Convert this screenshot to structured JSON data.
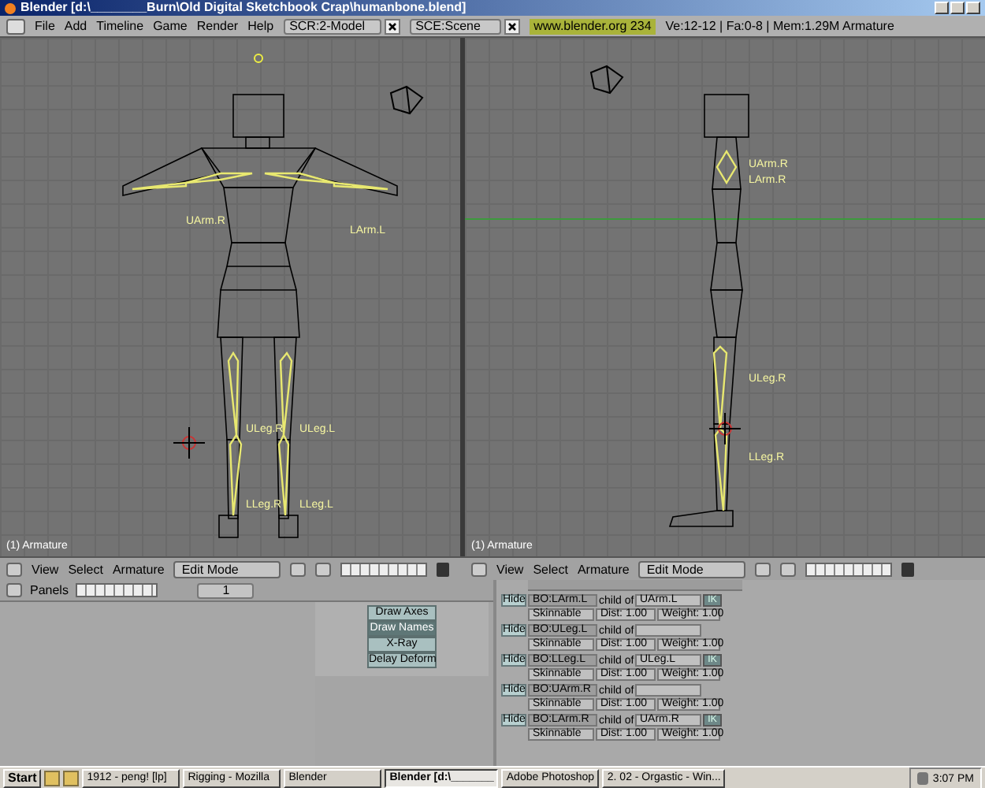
{
  "window": {
    "title": "Blender [d:\\________Burn\\Old Digital Sketchbook Crap\\humanbone.blend]"
  },
  "menu_bar": {
    "menus": [
      "File",
      "Add",
      "Timeline",
      "Game",
      "Render",
      "Help"
    ],
    "screen": "SCR:2-Model",
    "scene": "SCE:Scene",
    "version": "www.blender.org 234",
    "stats": "Ve:12-12 | Fa:0-8 | Mem:1.29M Armature"
  },
  "viewports": [
    {
      "kind": "front",
      "object_label": "(1) Armature",
      "bone_labels": [
        "UArm.R",
        "LArm.L",
        "ULeg.R",
        "ULeg.L",
        "LLeg.R",
        "LLeg.L"
      ],
      "header": {
        "menus": [
          "View",
          "Select",
          "Armature"
        ],
        "mode": "Edit Mode"
      }
    },
    {
      "kind": "side",
      "object_label": "(1) Armature",
      "bone_labels": [
        "UArm.R",
        "LArm.R",
        "ULeg.R",
        "LLeg.R"
      ],
      "header": {
        "menus": [
          "View",
          "Select",
          "Armature"
        ],
        "mode": "Edit Mode"
      }
    }
  ],
  "buttons_header": {
    "panels": "Panels",
    "frame": "1"
  },
  "draw_buttons": [
    {
      "label": "Draw Axes",
      "selected": false
    },
    {
      "label": "Draw Names",
      "selected": true
    },
    {
      "label": "X-Ray",
      "selected": false
    },
    {
      "label": "Delay Deform",
      "selected": false
    }
  ],
  "bones": [
    {
      "hide": "Hide",
      "name": "BO:LArm.L",
      "child_of": "child of",
      "parent": "UArm.L",
      "ik": "IK",
      "skinnable": "Skinnable",
      "dist": "Dist: 1.00",
      "weight": "Weight: 1.00"
    },
    {
      "hide": "Hide",
      "name": "BO:ULeg.L",
      "child_of": "child of",
      "skinnable": "Skinnable",
      "dist": "Dist: 1.00",
      "weight": "Weight: 1.00"
    },
    {
      "hide": "Hide",
      "name": "BO:LLeg.L",
      "child_of": "child of",
      "parent": "ULeg.L",
      "ik": "IK",
      "skinnable": "Skinnable",
      "dist": "Dist: 1.00",
      "weight": "Weight: 1.00"
    },
    {
      "hide": "Hide",
      "name": "BO:UArm.R",
      "child_of": "child of",
      "skinnable": "Skinnable",
      "dist": "Dist: 1.00",
      "weight": "Weight: 1.00"
    },
    {
      "hide": "Hide",
      "name": "BO:LArm.R",
      "child_of": "child of",
      "parent": "UArm.R",
      "ik": "IK",
      "skinnable": "Skinnable",
      "dist": "Dist: 1.00",
      "weight": "Weight: 1.00"
    }
  ],
  "taskbar": {
    "start": "Start",
    "items": [
      {
        "label": "1912 - peng! [lp]",
        "selected": false
      },
      {
        "label": "Rigging - Mozilla",
        "selected": false
      },
      {
        "label": "Blender",
        "selected": false
      },
      {
        "label": "Blender [d:\\_______",
        "selected": true
      },
      {
        "label": "Adobe Photoshop",
        "selected": false
      },
      {
        "label": "2. 02 - Orgastic - Win...",
        "selected": false
      }
    ],
    "clock": "3:07 PM"
  }
}
